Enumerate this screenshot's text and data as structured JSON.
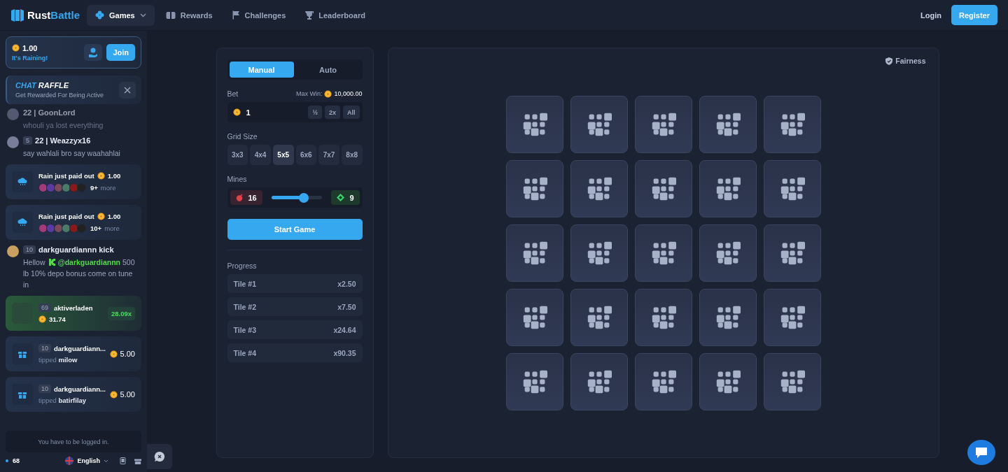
{
  "nav": {
    "logo_a": "Rust",
    "logo_b": "Battle",
    "items": [
      {
        "label": "Games",
        "selected": true,
        "dropdown": true
      },
      {
        "label": "Rewards",
        "selected": false,
        "dropdown": false
      },
      {
        "label": "Challenges",
        "selected": false,
        "dropdown": false
      },
      {
        "label": "Leaderboard",
        "selected": false,
        "dropdown": false
      }
    ],
    "login": "Login",
    "register": "Register"
  },
  "sidebar": {
    "rain": {
      "amount": "1.00",
      "label": "It's Raining!",
      "join": "Join"
    },
    "raffle": {
      "title_a": "CHAT",
      "title_b": "RAFFLE",
      "subtitle": "Get Rewarded For Being Active"
    },
    "feed": [
      {
        "kind": "message",
        "faded": true,
        "name": "22 | GoonLord",
        "text": "whouli ya lost everything"
      },
      {
        "kind": "message",
        "faded": false,
        "level": "5",
        "name": "22 | Weazzyx16",
        "text": "say wahlali bro say waahahlai"
      },
      {
        "kind": "rain",
        "title": "Rain just paid out",
        "amount": "1.00",
        "more": "9+",
        "more_label": "more"
      },
      {
        "kind": "rain",
        "title": "Rain just paid out",
        "amount": "1.00",
        "more": "10+",
        "more_label": "more"
      },
      {
        "kind": "mention_message",
        "faded": false,
        "level": "10",
        "name": "darkguardiannn kick",
        "parts": [
          {
            "kind": "text",
            "text": "Hellow"
          },
          {
            "kind": "mention",
            "text": "@darkguardiannn"
          },
          {
            "kind": "text",
            "text": "500 lb 10% depo bonus come on tune in"
          }
        ]
      },
      {
        "kind": "win",
        "level": "69",
        "name": "aktiverladen",
        "amount": "31.74",
        "multiplier": "28.09x"
      },
      {
        "kind": "tip",
        "level": "10",
        "name": "darkguardiann...",
        "text": "tipped **milow**",
        "amount": "5.00"
      },
      {
        "kind": "tip",
        "level": "10",
        "name": "darkguardiann...",
        "text": "tipped **batirfilay**",
        "amount": "5.00"
      }
    ],
    "notice": "You have to be logged in.",
    "online": "68",
    "language": "English"
  },
  "panel": {
    "modes": [
      {
        "label": "Manual",
        "selected": true
      },
      {
        "label": "Auto",
        "selected": false
      }
    ],
    "bet": {
      "label": "Bet",
      "max_win_label": "Max Win:",
      "max_win": "10,000.00",
      "value": "1",
      "buttons": [
        "½",
        "2x",
        "All"
      ]
    },
    "grid": {
      "label": "Grid Size",
      "options": [
        {
          "label": "3x3",
          "selected": false
        },
        {
          "label": "4x4",
          "selected": false
        },
        {
          "label": "5x5",
          "selected": true
        },
        {
          "label": "6x6",
          "selected": false
        },
        {
          "label": "7x7",
          "selected": false
        },
        {
          "label": "8x8",
          "selected": false
        }
      ]
    },
    "mines": {
      "label": "Mines",
      "mines": "16",
      "gems": "9",
      "level": 0.64
    },
    "start": "Start Game",
    "progress": {
      "label": "Progress",
      "rows": [
        {
          "label": "Tile #1",
          "value": "x2.50"
        },
        {
          "label": "Tile #2",
          "value": "x7.50"
        },
        {
          "label": "Tile #3",
          "value": "x24.64"
        },
        {
          "label": "Tile #4",
          "value": "x90.35"
        }
      ]
    }
  },
  "board": {
    "fairness": "Fairness",
    "tiles": [
      {
        "kind": "hidden"
      },
      {
        "kind": "hidden"
      },
      {
        "kind": "hidden"
      },
      {
        "kind": "hidden"
      },
      {
        "kind": "hidden"
      },
      {
        "kind": "hidden"
      },
      {
        "kind": "hidden"
      },
      {
        "kind": "hidden"
      },
      {
        "kind": "hidden"
      },
      {
        "kind": "hidden"
      },
      {
        "kind": "hidden"
      },
      {
        "kind": "hidden"
      },
      {
        "kind": "hidden"
      },
      {
        "kind": "hidden"
      },
      {
        "kind": "hidden"
      },
      {
        "kind": "hidden"
      },
      {
        "kind": "hidden"
      },
      {
        "kind": "hidden"
      },
      {
        "kind": "hidden"
      },
      {
        "kind": "hidden"
      },
      {
        "kind": "hidden"
      },
      {
        "kind": "hidden"
      },
      {
        "kind": "hidden"
      },
      {
        "kind": "hidden"
      },
      {
        "kind": "hidden"
      }
    ]
  }
}
